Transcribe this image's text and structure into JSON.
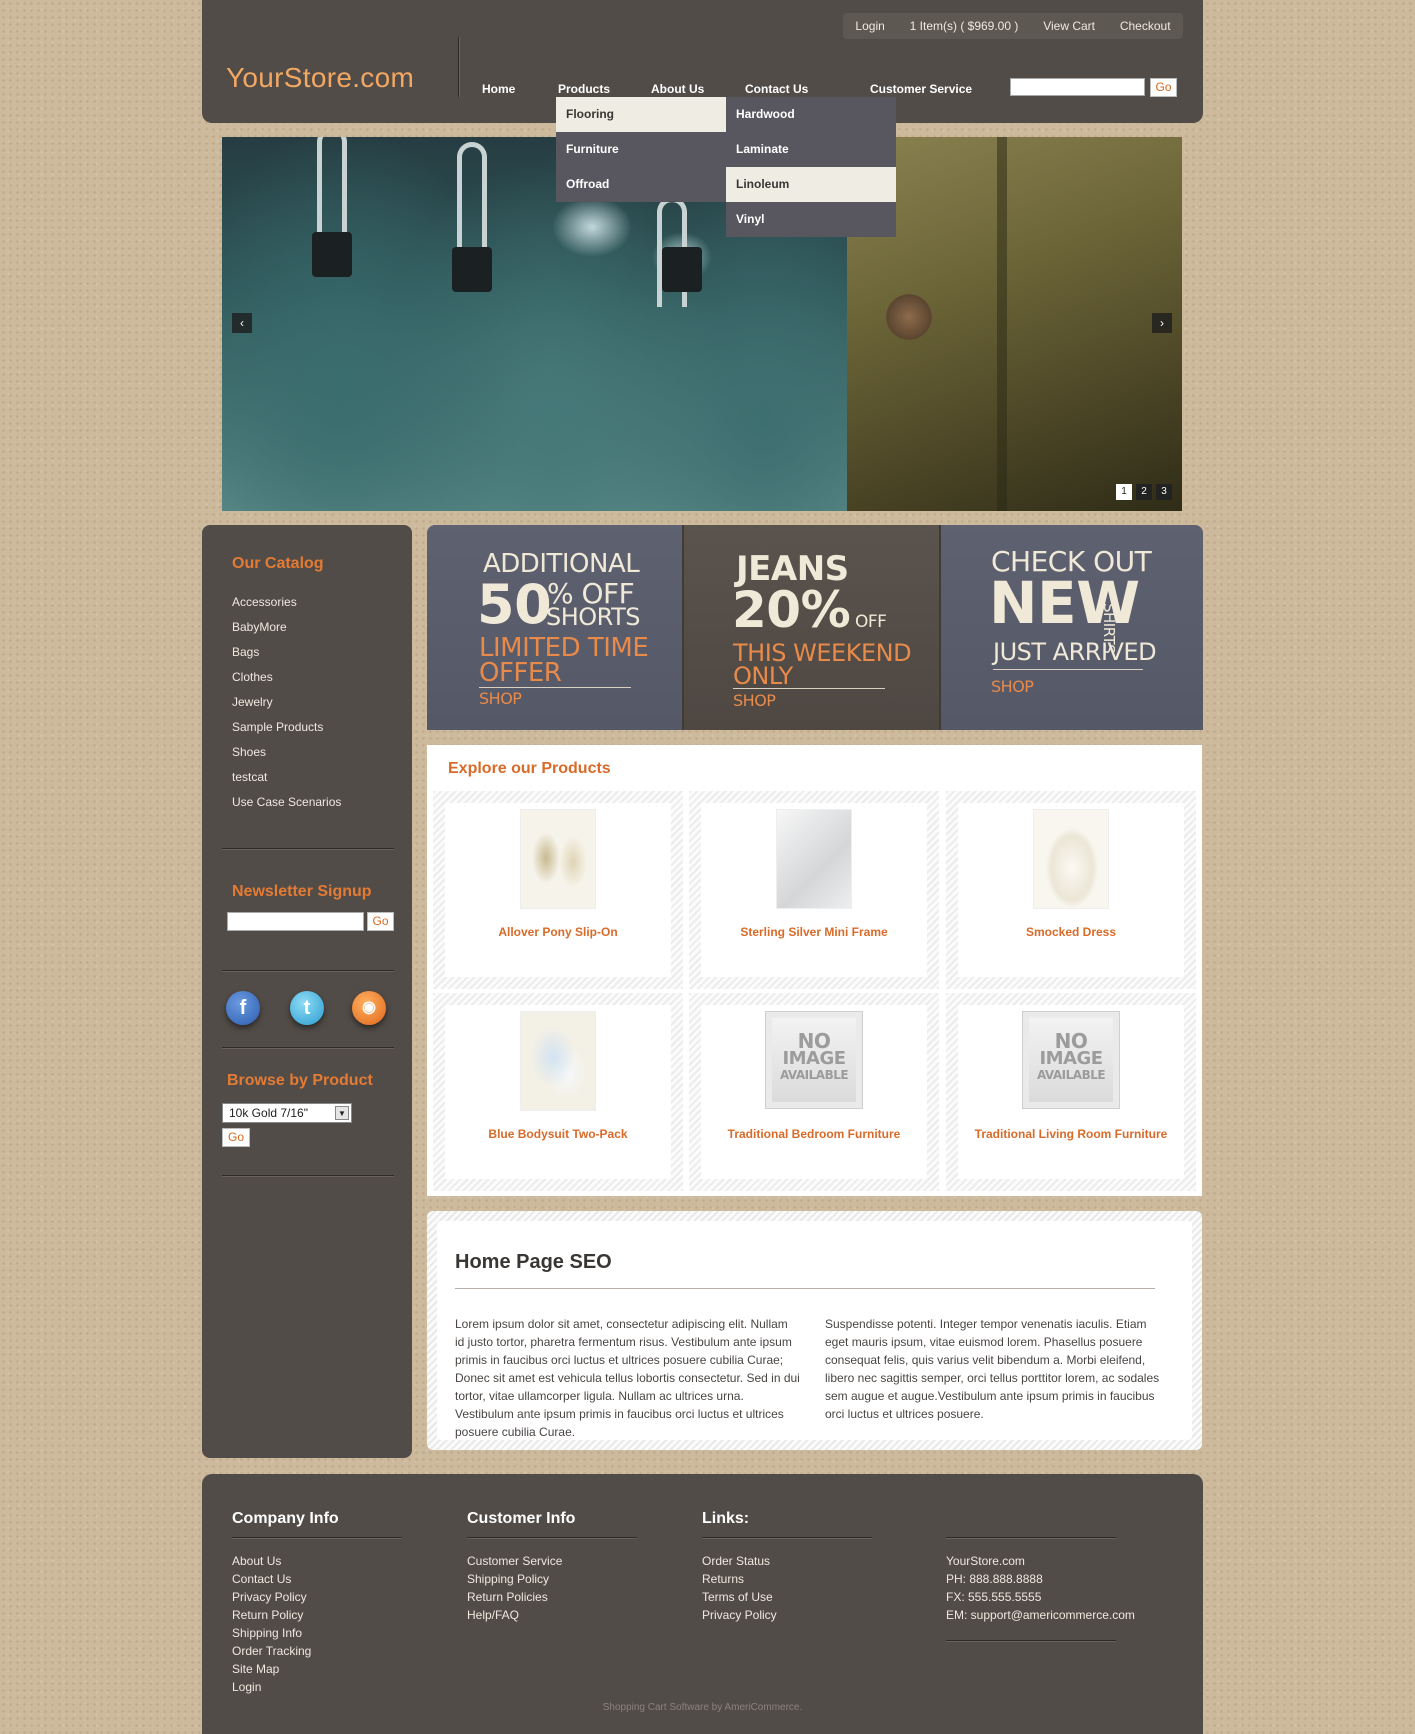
{
  "header": {
    "logo": "YourStore.com",
    "topbar": [
      "Login",
      "1 Item(s) ( $969.00 )",
      "View Cart",
      "Checkout"
    ],
    "nav": [
      "Home",
      "Products",
      "About Us",
      "Contact Us",
      "Customer Service"
    ],
    "search_value": "",
    "search_go": "Go"
  },
  "dropdown": {
    "col1": [
      "Flooring",
      "Furniture",
      "Offroad"
    ],
    "col2": [
      "Hardwood",
      "Laminate",
      "Linoleum",
      "Vinyl"
    ],
    "active_col1": "Flooring",
    "active_col2": "Linoleum"
  },
  "slider": {
    "prev": "‹",
    "next": "›",
    "pages": [
      "1",
      "2",
      "3"
    ],
    "current_page": "1"
  },
  "sidebar": {
    "catalog_title": "Our Catalog",
    "catalog": [
      "Accessories",
      "BabyMore",
      "Bags",
      "Clothes",
      "Jewelry",
      "Sample Products",
      "Shoes",
      "testcat",
      "Use Case Scenarios"
    ],
    "newsletter_title": "Newsletter Signup",
    "newsletter_go": "Go",
    "social": [
      "facebook-icon",
      "twitter-icon",
      "rss-icon"
    ],
    "browse_title": "Browse by Product",
    "browse_selected": "10k Gold 7/16\"",
    "browse_go": "Go"
  },
  "promos": {
    "p1": {
      "line1": "ADDITIONAL",
      "big": "50",
      "pct": "% OFF",
      "sub": "SHORTS",
      "offer1": "LIMITED TIME",
      "offer2": "OFFER",
      "shop": "SHOP"
    },
    "p2": {
      "line1": "JEANS",
      "big": "20%",
      "off": "OFF",
      "offer1": "THIS WEEKEND",
      "offer2": "ONLY",
      "shop": "SHOP"
    },
    "p3": {
      "line1": "CHECK OUT",
      "big": "NEW",
      "side": "SHIRTS",
      "offer1": "JUST ARRIVED",
      "shop": "SHOP"
    }
  },
  "products": {
    "title": "Explore our Products",
    "items": [
      {
        "name": "Allover Pony Slip-On",
        "image": "shoes"
      },
      {
        "name": "Sterling Silver Mini Frame",
        "image": "frame"
      },
      {
        "name": "Smocked Dress",
        "image": "dress"
      },
      {
        "name": "Blue Bodysuit Two-Pack",
        "image": "bodysuit"
      },
      {
        "name": "Traditional Bedroom Furniture",
        "image": "no-image"
      },
      {
        "name": "Traditional Living Room Furniture",
        "image": "no-image"
      }
    ],
    "no_image_text": [
      "NO",
      "IMAGE",
      "AVAILABLE"
    ]
  },
  "seo": {
    "title": "Home Page SEO",
    "col1": "Lorem ipsum dolor sit amet, consectetur adipiscing elit. Nullam id justo tortor, pharetra fermentum risus. Vestibulum ante ipsum primis in faucibus orci luctus et ultrices posuere cubilia Curae; Donec sit amet est vehicula tellus lobortis consectetur. Sed in dui tortor, vitae ullamcorper ligula. Nullam ac ultrices urna. Vestibulum ante ipsum primis in faucibus orci luctus et ultrices posuere cubilia Curae.",
    "col2": "Suspendisse potenti. Integer tempor venenatis iaculis. Etiam eget mauris ipsum, vitae euismod lorem. Phasellus posuere consequat felis, quis varius velit bibendum a. Morbi eleifend, libero nec sagittis semper, orci tellus porttitor lorem, ac sodales sem augue et augue.Vestibulum ante ipsum primis in faucibus orci luctus et ultrices posuere."
  },
  "footer": {
    "company_title": "Company Info",
    "company": [
      "About Us",
      "Contact Us",
      "Privacy Policy",
      "Return Policy",
      "Shipping Info",
      "Order Tracking",
      "Site Map",
      "Login"
    ],
    "customer_title": "Customer Info",
    "customer": [
      "Customer Service",
      "Shipping Policy",
      "Return Policies",
      "Help/FAQ"
    ],
    "links_title": "Links:",
    "links": [
      "Order Status",
      "Returns",
      "Terms of Use",
      "Privacy Policy"
    ],
    "contact": [
      "YourStore.com",
      "PH: 888.888.8888",
      "FX: 555.555.5555",
      "EM: support@americommerce.com"
    ],
    "credit": "Shopping Cart Software by AmeriCommerce."
  },
  "colors": {
    "accent": "#d86b2a",
    "panel": "#524c48",
    "background": "#cdb99b"
  }
}
